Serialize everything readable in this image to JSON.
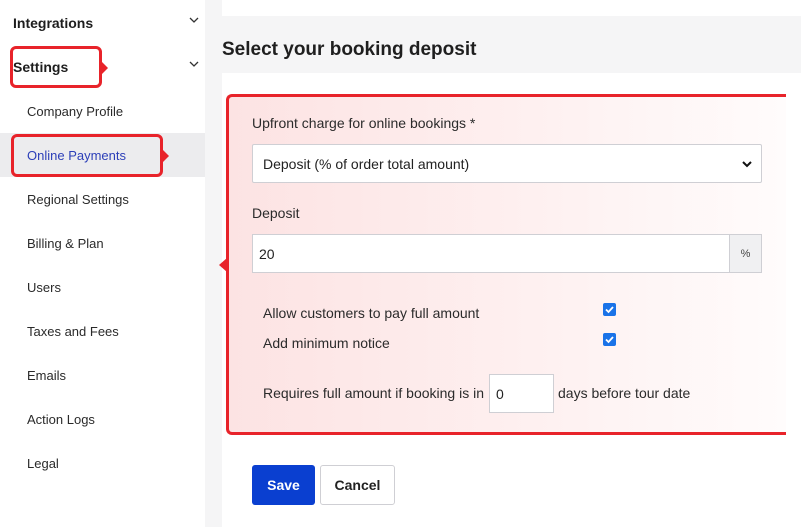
{
  "sidebar": {
    "sections": [
      {
        "label": "Integrations",
        "icon": "chevron-down-icon"
      },
      {
        "label": "Settings",
        "icon": "chevron-down-icon"
      }
    ],
    "items": [
      {
        "label": "Company Profile"
      },
      {
        "label": "Online Payments",
        "active": true
      },
      {
        "label": "Regional Settings"
      },
      {
        "label": "Billing & Plan"
      },
      {
        "label": "Users"
      },
      {
        "label": "Taxes and Fees"
      },
      {
        "label": "Emails"
      },
      {
        "label": "Action Logs"
      },
      {
        "label": "Legal"
      }
    ]
  },
  "main": {
    "title": "Select your booking deposit",
    "upfront": {
      "label": "Upfront charge for online bookings *",
      "selected": "Deposit (% of order total amount)"
    },
    "deposit": {
      "label": "Deposit",
      "value": "20",
      "suffix": "%"
    },
    "options": [
      {
        "label": "Allow customers to pay full amount",
        "checked": true
      },
      {
        "label": "Add minimum notice",
        "checked": true
      }
    ],
    "requires": {
      "prefix": "Requires full amount if booking is in",
      "value": "0",
      "suffix": "days before tour date"
    },
    "buttons": {
      "save": "Save",
      "cancel": "Cancel"
    }
  },
  "colors": {
    "accent": "#0a3fd0",
    "active_nav_text": "#2c3fb8",
    "annotation": "#e8232a",
    "checkbox": "#1a73e8"
  }
}
